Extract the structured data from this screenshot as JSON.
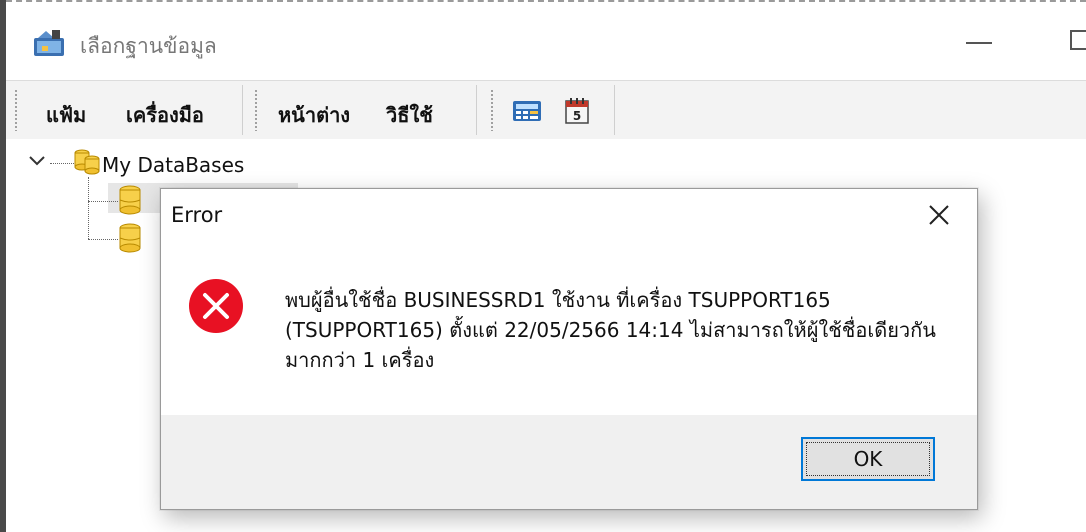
{
  "window": {
    "title": "เลือกฐานข้อมูล"
  },
  "menu": {
    "file": "แฟ้ม",
    "tools": "เครื่องมือ",
    "window": "หน้าต่าง",
    "help": "วิธีใช้"
  },
  "toolbar": {
    "icons": [
      "calculator-icon",
      "calendar-icon"
    ],
    "calendar_day": "5"
  },
  "tree": {
    "root_label": "My DataBases",
    "child_count": 2
  },
  "dialog": {
    "title": "Error",
    "message": "พบผู้อื่นใช้ชื่อ BUSINESSRD1 ใช้งาน ที่เครื่อง TSUPPORT165 (TSUPPORT165) ตั้งแต่ 22/05/2566 14:14 ไม่สามารถให้ผู้ใช้ชื่อเดียวกันมากกว่า 1 เครื่อง",
    "ok_label": "OK",
    "icon": "error-icon"
  },
  "colors": {
    "error_red": "#e81123",
    "focus_blue": "#0078d7"
  }
}
